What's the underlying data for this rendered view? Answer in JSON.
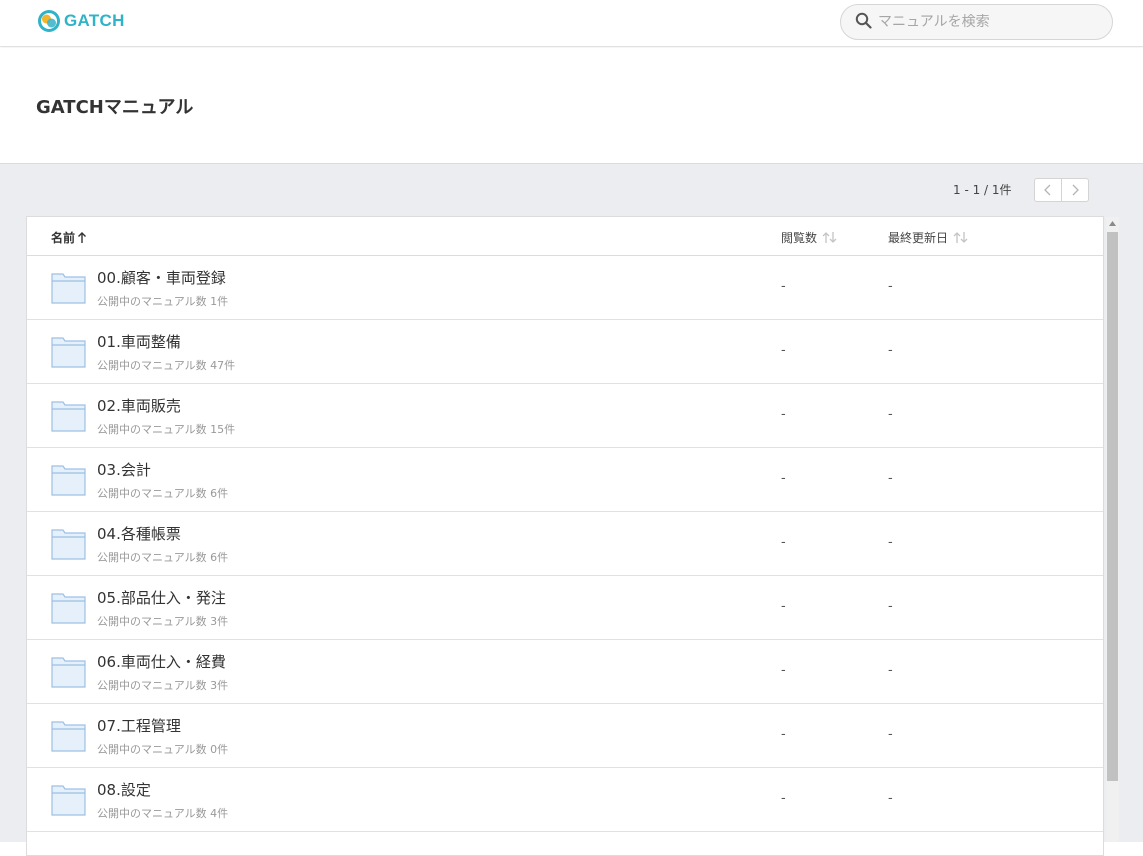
{
  "header": {
    "logo_text": "GATCH",
    "search_placeholder": "マニュアルを検索",
    "brand_color": "#2fb3c8"
  },
  "page_title": "GATCHマニュアル",
  "pagination": {
    "text": "1 - 1 / 1件"
  },
  "table": {
    "columns": {
      "name": "名前",
      "views": "閲覧数",
      "updated": "最終更新日"
    },
    "rows": [
      {
        "name": "00.顧客・車両登録",
        "count": "公開中のマニュアル数 1件",
        "views": "-",
        "updated": "-"
      },
      {
        "name": "01.車両整備",
        "count": "公開中のマニュアル数 47件",
        "views": "-",
        "updated": "-"
      },
      {
        "name": "02.車両販売",
        "count": "公開中のマニュアル数 15件",
        "views": "-",
        "updated": "-"
      },
      {
        "name": "03.会計",
        "count": "公開中のマニュアル数 6件",
        "views": "-",
        "updated": "-"
      },
      {
        "name": "04.各種帳票",
        "count": "公開中のマニュアル数 6件",
        "views": "-",
        "updated": "-"
      },
      {
        "name": "05.部品仕入・発注",
        "count": "公開中のマニュアル数 3件",
        "views": "-",
        "updated": "-"
      },
      {
        "name": "06.車両仕入・経費",
        "count": "公開中のマニュアル数 3件",
        "views": "-",
        "updated": "-"
      },
      {
        "name": "07.工程管理",
        "count": "公開中のマニュアル数 0件",
        "views": "-",
        "updated": "-"
      },
      {
        "name": "08.設定",
        "count": "公開中のマニュアル数 4件",
        "views": "-",
        "updated": "-"
      }
    ]
  }
}
